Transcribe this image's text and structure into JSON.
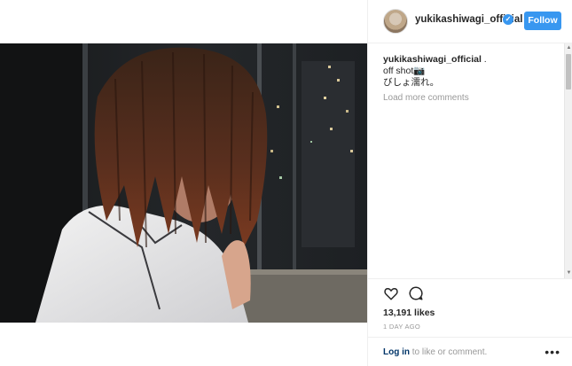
{
  "post": {
    "username": "yukikashiwagi_official",
    "follow_label": "Follow",
    "caption_username": "yukikashiwagi_official",
    "caption_suffix": " .",
    "caption_line2": "off shot📷",
    "caption_line3": "びしょ濡れ。",
    "load_more": "Load more comments",
    "likes": "13,191 likes",
    "age": "1 DAY AGO",
    "login_link": "Log in",
    "login_rest": " to like or comment.",
    "more": "•••"
  },
  "colors": {
    "accent": "#3897f0",
    "link": "#003569",
    "muted": "#999999",
    "border": "#efefef"
  },
  "icons": {
    "verified": "verified-badge-icon",
    "like": "heart-icon",
    "comment": "comment-bubble-icon",
    "more": "more-options-icon"
  }
}
